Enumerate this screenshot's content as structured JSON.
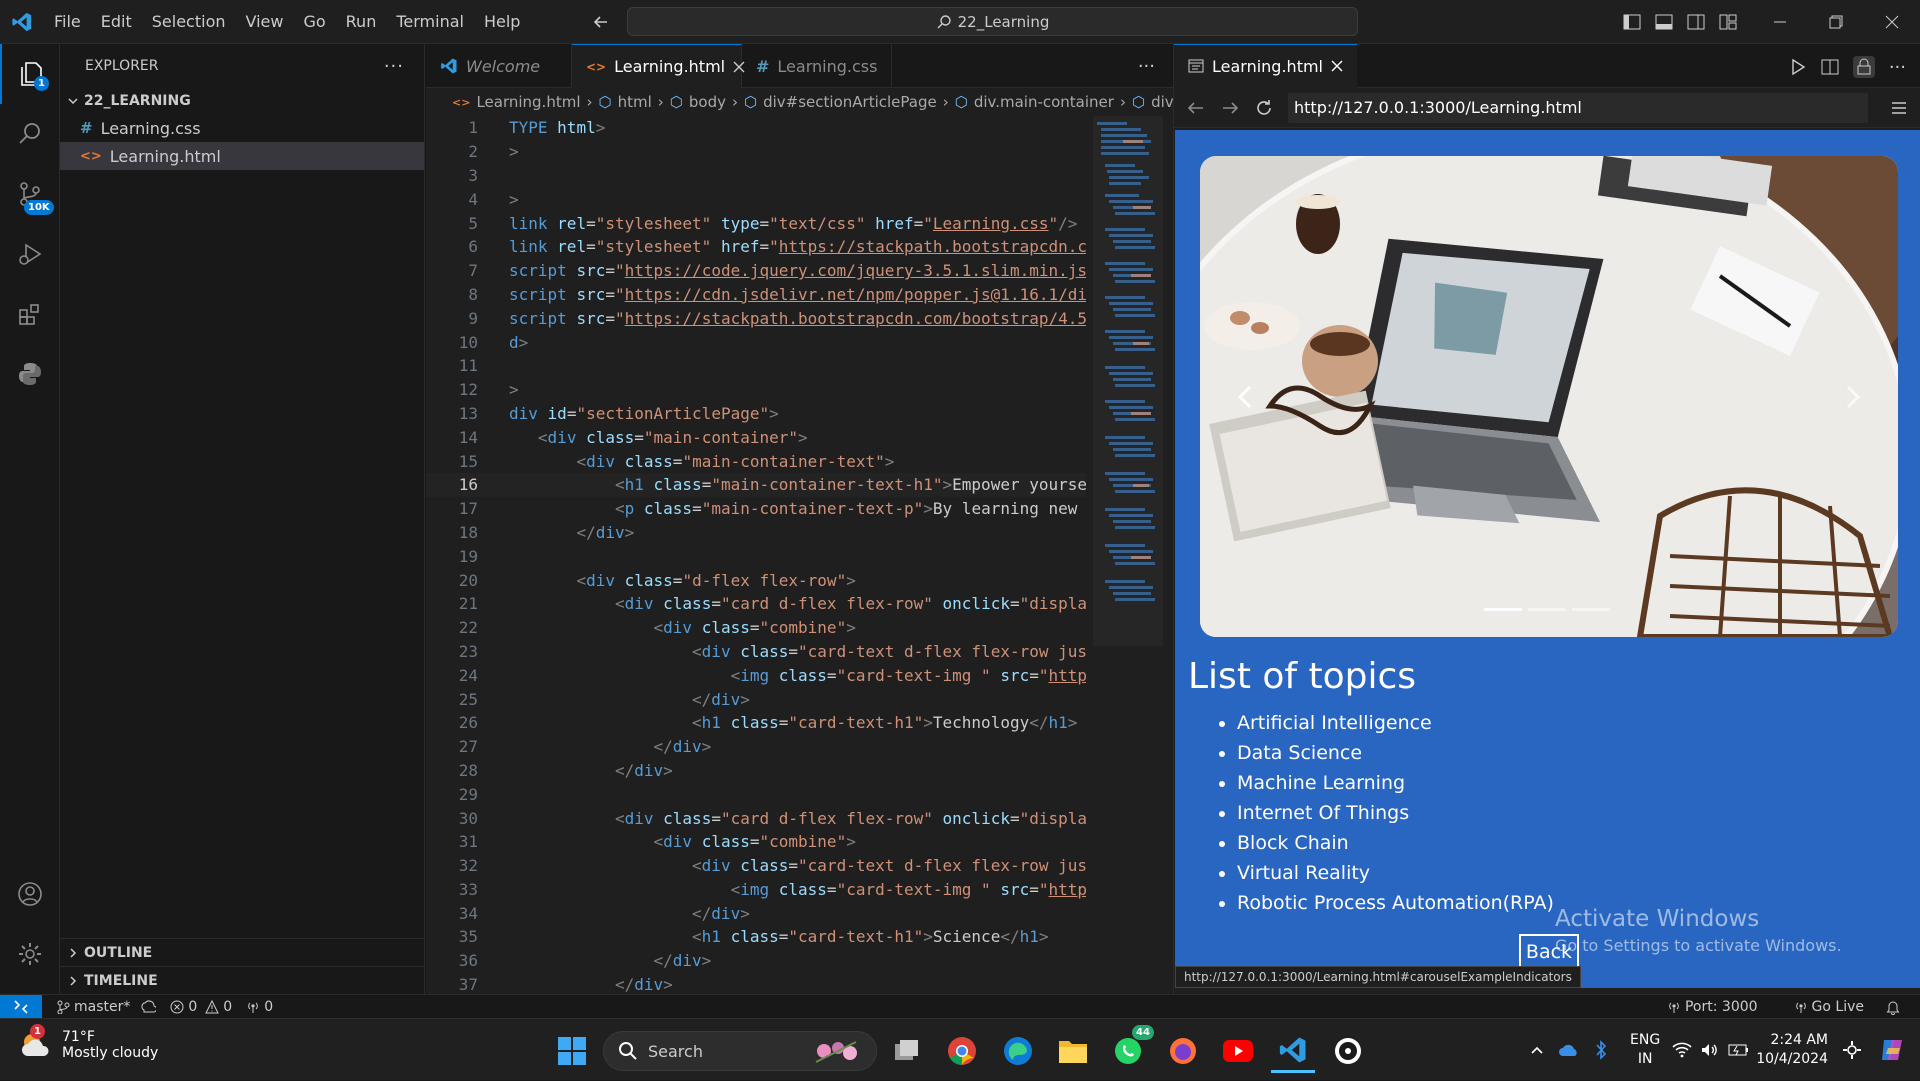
{
  "titlebar": {
    "menu": [
      "File",
      "Edit",
      "Selection",
      "View",
      "Go",
      "Run",
      "Terminal",
      "Help"
    ],
    "command_center": "22_Learning"
  },
  "activity": {
    "explorer_badge": "1",
    "scm_badge": "10K"
  },
  "explorer": {
    "header": "EXPLORER",
    "folder": "22_LEARNING",
    "files": [
      "Learning.css",
      "Learning.html"
    ],
    "outline": "OUTLINE",
    "timeline": "TIMELINE"
  },
  "editor": {
    "tabs": [
      "Welcome",
      "Learning.html",
      "Learning.css"
    ],
    "breadcrumbs": [
      "Learning.html",
      "html",
      "body",
      "div#sectionArticlePage",
      "div.main-container",
      "div"
    ],
    "current_line": 16
  },
  "preview": {
    "tab": "Learning.html",
    "url": "http://127.0.0.1:3000/Learning.html",
    "topics_title": "List of topics",
    "topics": [
      "Artificial Intelligence",
      "Data Science",
      "Machine Learning",
      "Internet Of Things",
      "Block Chain",
      "Virtual Reality",
      "Robotic Process Automation(RPA)"
    ],
    "back": "Back",
    "watermark_1": "Activate Windows",
    "watermark_2": "Go to Settings to activate Windows.",
    "hover_url": "http://127.0.0.1:3000/Learning.html#carouselExampleIndicators"
  },
  "status": {
    "branch": "master*",
    "errors": "0",
    "warnings": "0",
    "ports_count": "0",
    "port": "Port: 3000",
    "golive": "Go Live"
  },
  "taskbar": {
    "temp": "71°F",
    "weather": "Mostly cloudy",
    "weather_badge": "1",
    "search": "Search",
    "whatsapp_badge": "44",
    "lang1": "ENG",
    "lang2": "IN",
    "time": "2:24 AM",
    "date": "10/4/2024"
  }
}
